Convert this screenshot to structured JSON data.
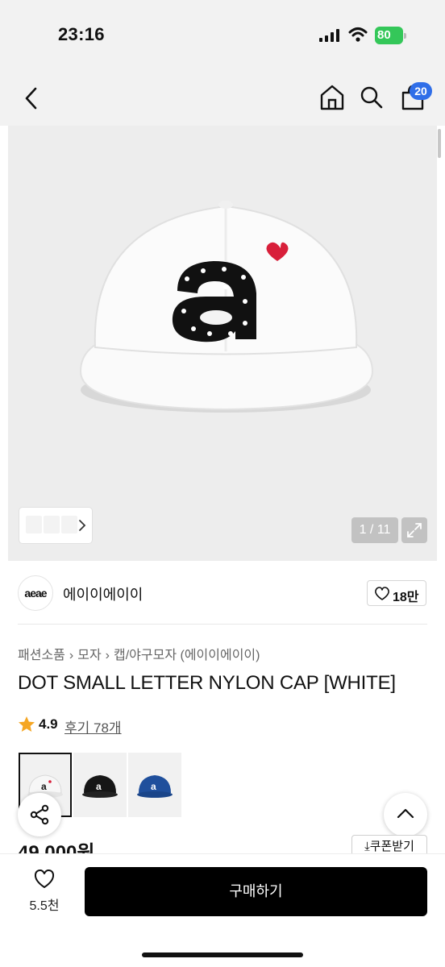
{
  "status": {
    "time": "23:16",
    "battery": "80"
  },
  "header": {
    "cart_count": "20"
  },
  "gallery": {
    "counter": "1 / 11"
  },
  "brand": {
    "logo_text": "aeae",
    "name": "에이이에이이",
    "likes": "18만"
  },
  "breadcrumb": [
    "패션소품",
    "모자",
    "캡/야구모자 (에이이에이이)"
  ],
  "product": {
    "title": "DOT SMALL LETTER NYLON CAP [WHITE]",
    "rating": "4.9",
    "reviews": "후기 78개",
    "price": "49,000원"
  },
  "swatches": [
    {
      "color": "#f6f6f6",
      "logo": "#111111"
    },
    {
      "color": "#161616",
      "logo": "#ffffff"
    },
    {
      "color": "#1f4f9c",
      "logo": "#ffffff"
    }
  ],
  "coupon_label": "⤓쿠폰받기",
  "bottom": {
    "wish_count": "5.5천",
    "buy_label": "구매하기"
  },
  "colors": {
    "badge": "#2f6ee8",
    "star": "#f5a623",
    "heart": "#d81f3a",
    "buy": "#000000"
  }
}
